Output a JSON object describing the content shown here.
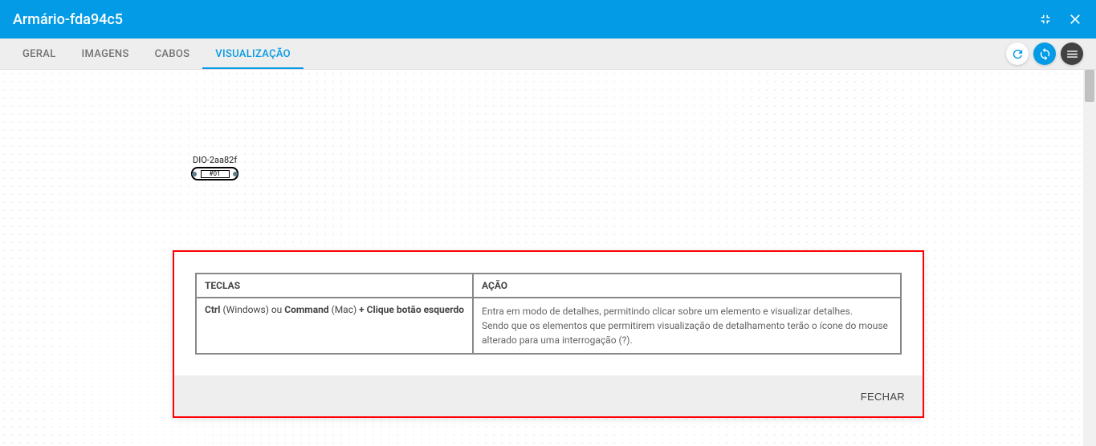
{
  "header": {
    "title": "Armário-fda94c5"
  },
  "tabs": {
    "items": [
      {
        "label": "GERAL"
      },
      {
        "label": "IMAGENS"
      },
      {
        "label": "CABOS"
      },
      {
        "label": "VISUALIZAÇÃO"
      }
    ]
  },
  "device": {
    "label": "DIO-2aa82f",
    "port": "#01"
  },
  "dialog": {
    "headers": {
      "keys": "TECLAS",
      "action": "AÇÃO"
    },
    "row": {
      "keys": {
        "ctrl": "Ctrl",
        "windows": " (Windows) ou ",
        "command": "Command",
        "mac": " (Mac) ",
        "plus": "+ Clique botão esquerdo"
      },
      "action_line1": "Entra em modo de detalhes, permitindo clicar sobre um elemento e visualizar detalhes.",
      "action_line2": "Sendo que os elementos que permitirem visualização de detalhamento terão o ícone do mouse alterado para uma interrogação (?)."
    },
    "close_label": "FECHAR"
  }
}
